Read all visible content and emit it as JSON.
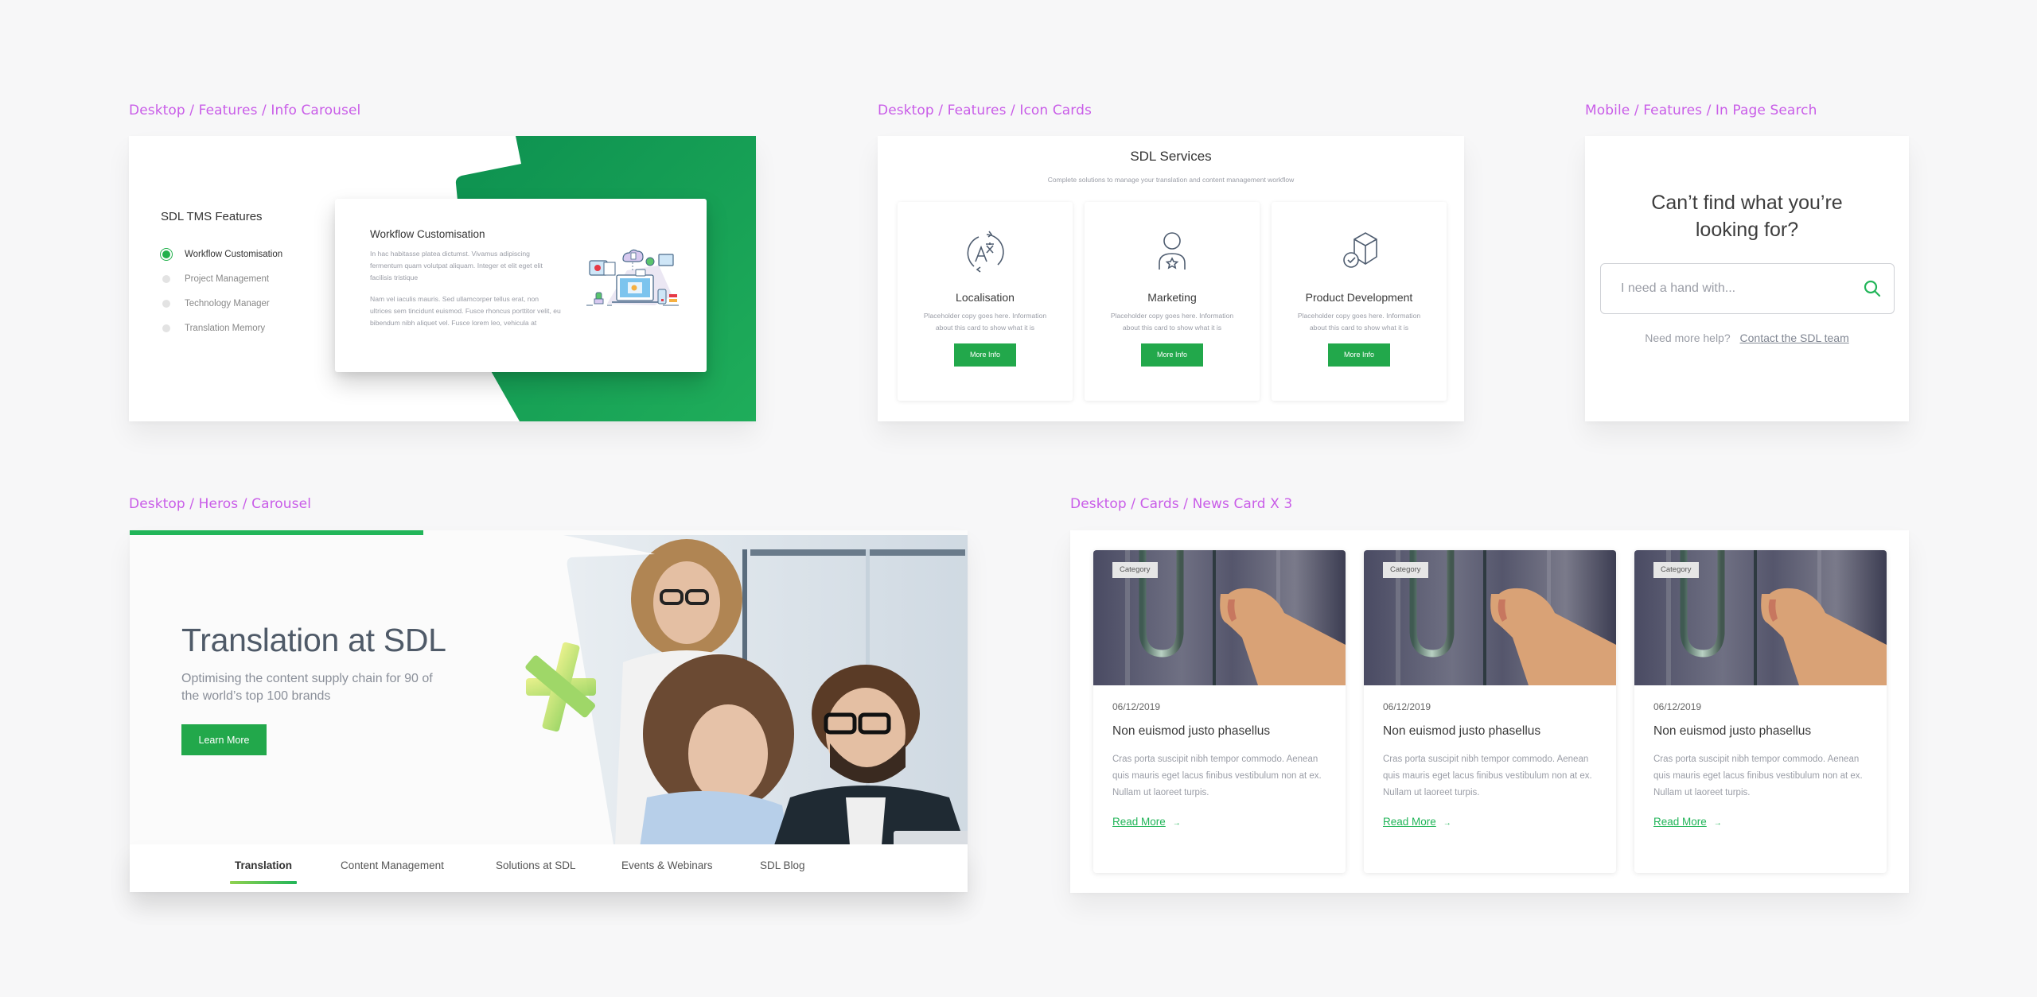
{
  "frames": {
    "info_carousel": "Desktop / Features / Info Carousel",
    "icon_cards": "Desktop / Features / Icon Cards",
    "in_page_search": "Mobile / Features / In Page Search",
    "hero_carousel": "Desktop / Heros / Carousel",
    "news_cards": "Desktop / Cards / News Card X 3"
  },
  "colors": {
    "brand_green": "#22a84b",
    "accent_green": "#22b559",
    "frame_label": "#c95de8",
    "dark_green": "#0f9a54"
  },
  "info_carousel": {
    "title": "SDL TMS Features",
    "features": [
      {
        "label": "Workflow Customisation",
        "active": true
      },
      {
        "label": "Project Management",
        "active": false
      },
      {
        "label": "Technology Manager",
        "active": false
      },
      {
        "label": "Translation Memory",
        "active": false
      }
    ],
    "card": {
      "title": "Workflow Customisation",
      "paragraph_1": "In hac habitasse platea dictumst. Vivamus adipiscing fermentum quam volutpat aliquam. Integer et elit eget elit facilisis tristique",
      "paragraph_2": "Nam vel iaculis mauris. Sed ullamcorper tellus erat, non ultrices sem tincidunt euismod. Fusce rhoncus porttitor velit, eu bibendum nibh aliquet vel. Fusce lorem leo, vehicula at",
      "illustration": "workflow-illustration"
    }
  },
  "icon_cards": {
    "title": "SDL Services",
    "subtitle": "Complete solutions to manage your translation and content management workflow",
    "cards": [
      {
        "icon": "translate-icon",
        "title": "Localisation",
        "copy": "Placeholder copy goes here. Information about this card to show what it is",
        "button": "More Info"
      },
      {
        "icon": "user-star-icon",
        "title": "Marketing",
        "copy": "Placeholder copy goes here. Information about this card to show what it is",
        "button": "More Info"
      },
      {
        "icon": "box-check-icon",
        "title": "Product Development",
        "copy": "Placeholder copy goes here. Information about this card to show what it is",
        "button": "More Info"
      }
    ]
  },
  "in_page_search": {
    "heading": "Can’t find what you’re looking for?",
    "placeholder": "I need a hand with...",
    "value": "",
    "help_text": "Need more help?",
    "help_link": "Contact the SDL team",
    "search_icon": "search-icon"
  },
  "hero_carousel": {
    "progress_percent": 35,
    "title": "Translation at SDL",
    "subtitle": "Optimising the content supply chain for 90 of the world’s top 100 brands",
    "cta": "Learn More",
    "nav": [
      {
        "label": "Translation",
        "active": true
      },
      {
        "label": "Content Management",
        "active": false
      },
      {
        "label": "Solutions at SDL",
        "active": false
      },
      {
        "label": "Events & Webinars",
        "active": false
      },
      {
        "label": "SDL Blog",
        "active": false
      }
    ]
  },
  "news_cards": {
    "cards": [
      {
        "category": "Category",
        "date": "06/12/2019",
        "title": "Non euismod justo phasellus",
        "copy": "Cras porta suscipit nibh tempor commodo. Aenean quis mauris eget lacus finibus vestibulum non at ex. Nullam ut laoreet turpis.",
        "link": "Read More",
        "arrow": "→"
      },
      {
        "category": "Category",
        "date": "06/12/2019",
        "title": "Non euismod justo phasellus",
        "copy": "Cras porta suscipit nibh tempor commodo. Aenean quis mauris eget lacus finibus vestibulum non at ex. Nullam ut laoreet turpis.",
        "link": "Read More",
        "arrow": "→"
      },
      {
        "category": "Category",
        "date": "06/12/2019",
        "title": "Non euismod justo phasellus",
        "copy": "Cras porta suscipit nibh tempor commodo. Aenean quis mauris eget lacus finibus vestibulum non at ex. Nullam ut laoreet turpis.",
        "link": "Read More",
        "arrow": "→"
      }
    ]
  }
}
